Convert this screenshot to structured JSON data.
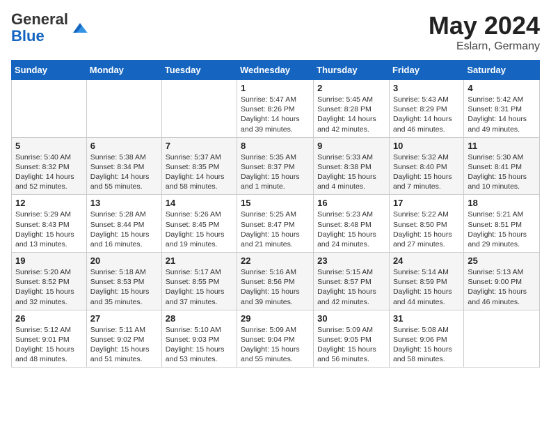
{
  "header": {
    "logo_general": "General",
    "logo_blue": "Blue",
    "month_title": "May 2024",
    "location": "Eslarn, Germany"
  },
  "days_of_week": [
    "Sunday",
    "Monday",
    "Tuesday",
    "Wednesday",
    "Thursday",
    "Friday",
    "Saturday"
  ],
  "weeks": [
    [
      {
        "day": "",
        "sunrise": "",
        "sunset": "",
        "daylight": ""
      },
      {
        "day": "",
        "sunrise": "",
        "sunset": "",
        "daylight": ""
      },
      {
        "day": "",
        "sunrise": "",
        "sunset": "",
        "daylight": ""
      },
      {
        "day": "1",
        "sunrise": "Sunrise: 5:47 AM",
        "sunset": "Sunset: 8:26 PM",
        "daylight": "Daylight: 14 hours and 39 minutes."
      },
      {
        "day": "2",
        "sunrise": "Sunrise: 5:45 AM",
        "sunset": "Sunset: 8:28 PM",
        "daylight": "Daylight: 14 hours and 42 minutes."
      },
      {
        "day": "3",
        "sunrise": "Sunrise: 5:43 AM",
        "sunset": "Sunset: 8:29 PM",
        "daylight": "Daylight: 14 hours and 46 minutes."
      },
      {
        "day": "4",
        "sunrise": "Sunrise: 5:42 AM",
        "sunset": "Sunset: 8:31 PM",
        "daylight": "Daylight: 14 hours and 49 minutes."
      }
    ],
    [
      {
        "day": "5",
        "sunrise": "Sunrise: 5:40 AM",
        "sunset": "Sunset: 8:32 PM",
        "daylight": "Daylight: 14 hours and 52 minutes."
      },
      {
        "day": "6",
        "sunrise": "Sunrise: 5:38 AM",
        "sunset": "Sunset: 8:34 PM",
        "daylight": "Daylight: 14 hours and 55 minutes."
      },
      {
        "day": "7",
        "sunrise": "Sunrise: 5:37 AM",
        "sunset": "Sunset: 8:35 PM",
        "daylight": "Daylight: 14 hours and 58 minutes."
      },
      {
        "day": "8",
        "sunrise": "Sunrise: 5:35 AM",
        "sunset": "Sunset: 8:37 PM",
        "daylight": "Daylight: 15 hours and 1 minute."
      },
      {
        "day": "9",
        "sunrise": "Sunrise: 5:33 AM",
        "sunset": "Sunset: 8:38 PM",
        "daylight": "Daylight: 15 hours and 4 minutes."
      },
      {
        "day": "10",
        "sunrise": "Sunrise: 5:32 AM",
        "sunset": "Sunset: 8:40 PM",
        "daylight": "Daylight: 15 hours and 7 minutes."
      },
      {
        "day": "11",
        "sunrise": "Sunrise: 5:30 AM",
        "sunset": "Sunset: 8:41 PM",
        "daylight": "Daylight: 15 hours and 10 minutes."
      }
    ],
    [
      {
        "day": "12",
        "sunrise": "Sunrise: 5:29 AM",
        "sunset": "Sunset: 8:43 PM",
        "daylight": "Daylight: 15 hours and 13 minutes."
      },
      {
        "day": "13",
        "sunrise": "Sunrise: 5:28 AM",
        "sunset": "Sunset: 8:44 PM",
        "daylight": "Daylight: 15 hours and 16 minutes."
      },
      {
        "day": "14",
        "sunrise": "Sunrise: 5:26 AM",
        "sunset": "Sunset: 8:45 PM",
        "daylight": "Daylight: 15 hours and 19 minutes."
      },
      {
        "day": "15",
        "sunrise": "Sunrise: 5:25 AM",
        "sunset": "Sunset: 8:47 PM",
        "daylight": "Daylight: 15 hours and 21 minutes."
      },
      {
        "day": "16",
        "sunrise": "Sunrise: 5:23 AM",
        "sunset": "Sunset: 8:48 PM",
        "daylight": "Daylight: 15 hours and 24 minutes."
      },
      {
        "day": "17",
        "sunrise": "Sunrise: 5:22 AM",
        "sunset": "Sunset: 8:50 PM",
        "daylight": "Daylight: 15 hours and 27 minutes."
      },
      {
        "day": "18",
        "sunrise": "Sunrise: 5:21 AM",
        "sunset": "Sunset: 8:51 PM",
        "daylight": "Daylight: 15 hours and 29 minutes."
      }
    ],
    [
      {
        "day": "19",
        "sunrise": "Sunrise: 5:20 AM",
        "sunset": "Sunset: 8:52 PM",
        "daylight": "Daylight: 15 hours and 32 minutes."
      },
      {
        "day": "20",
        "sunrise": "Sunrise: 5:18 AM",
        "sunset": "Sunset: 8:53 PM",
        "daylight": "Daylight: 15 hours and 35 minutes."
      },
      {
        "day": "21",
        "sunrise": "Sunrise: 5:17 AM",
        "sunset": "Sunset: 8:55 PM",
        "daylight": "Daylight: 15 hours and 37 minutes."
      },
      {
        "day": "22",
        "sunrise": "Sunrise: 5:16 AM",
        "sunset": "Sunset: 8:56 PM",
        "daylight": "Daylight: 15 hours and 39 minutes."
      },
      {
        "day": "23",
        "sunrise": "Sunrise: 5:15 AM",
        "sunset": "Sunset: 8:57 PM",
        "daylight": "Daylight: 15 hours and 42 minutes."
      },
      {
        "day": "24",
        "sunrise": "Sunrise: 5:14 AM",
        "sunset": "Sunset: 8:59 PM",
        "daylight": "Daylight: 15 hours and 44 minutes."
      },
      {
        "day": "25",
        "sunrise": "Sunrise: 5:13 AM",
        "sunset": "Sunset: 9:00 PM",
        "daylight": "Daylight: 15 hours and 46 minutes."
      }
    ],
    [
      {
        "day": "26",
        "sunrise": "Sunrise: 5:12 AM",
        "sunset": "Sunset: 9:01 PM",
        "daylight": "Daylight: 15 hours and 48 minutes."
      },
      {
        "day": "27",
        "sunrise": "Sunrise: 5:11 AM",
        "sunset": "Sunset: 9:02 PM",
        "daylight": "Daylight: 15 hours and 51 minutes."
      },
      {
        "day": "28",
        "sunrise": "Sunrise: 5:10 AM",
        "sunset": "Sunset: 9:03 PM",
        "daylight": "Daylight: 15 hours and 53 minutes."
      },
      {
        "day": "29",
        "sunrise": "Sunrise: 5:09 AM",
        "sunset": "Sunset: 9:04 PM",
        "daylight": "Daylight: 15 hours and 55 minutes."
      },
      {
        "day": "30",
        "sunrise": "Sunrise: 5:09 AM",
        "sunset": "Sunset: 9:05 PM",
        "daylight": "Daylight: 15 hours and 56 minutes."
      },
      {
        "day": "31",
        "sunrise": "Sunrise: 5:08 AM",
        "sunset": "Sunset: 9:06 PM",
        "daylight": "Daylight: 15 hours and 58 minutes."
      },
      {
        "day": "",
        "sunrise": "",
        "sunset": "",
        "daylight": ""
      }
    ]
  ]
}
